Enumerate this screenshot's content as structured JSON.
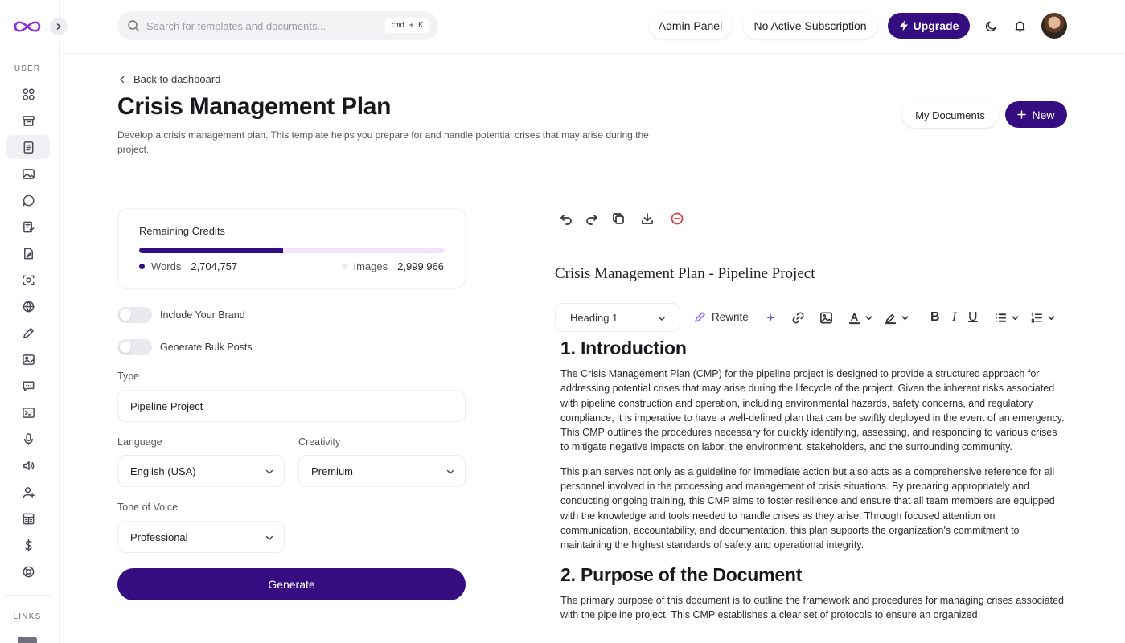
{
  "sidebar": {
    "section_user": "USER",
    "section_links": "LINKS",
    "items": [
      {
        "name": "sidebar-item-dashboard",
        "icon": "grid-icon"
      },
      {
        "name": "sidebar-item-archive",
        "icon": "archive-icon"
      },
      {
        "name": "sidebar-item-documents",
        "icon": "document-icon",
        "active": true
      },
      {
        "name": "sidebar-item-images",
        "icon": "image-icon"
      },
      {
        "name": "sidebar-item-chat",
        "icon": "chat-icon"
      },
      {
        "name": "sidebar-item-forms",
        "icon": "list-check-icon"
      },
      {
        "name": "sidebar-item-file-edit",
        "icon": "file-edit-icon"
      },
      {
        "name": "sidebar-item-vision",
        "icon": "scan-face-icon"
      },
      {
        "name": "sidebar-item-web",
        "icon": "globe-icon"
      },
      {
        "name": "sidebar-item-editor",
        "icon": "pen-icon"
      },
      {
        "name": "sidebar-item-image-gen",
        "icon": "image-icon"
      },
      {
        "name": "sidebar-item-chat-bot",
        "icon": "message-icon"
      },
      {
        "name": "sidebar-item-code",
        "icon": "terminal-icon"
      },
      {
        "name": "sidebar-item-speech",
        "icon": "mic-icon"
      },
      {
        "name": "sidebar-item-voiceover",
        "icon": "speaker-icon"
      },
      {
        "name": "sidebar-item-affiliates",
        "icon": "user-plus-icon"
      },
      {
        "name": "sidebar-item-plans",
        "icon": "table-icon"
      },
      {
        "name": "sidebar-item-billing",
        "icon": "dollar-icon"
      },
      {
        "name": "sidebar-item-support",
        "icon": "lifebuoy-icon"
      }
    ]
  },
  "topbar": {
    "search_placeholder": "Search for templates and documents...",
    "shortcut": "cmd + K",
    "admin_panel": "Admin Panel",
    "subscription": "No Active Subscription",
    "upgrade": "Upgrade"
  },
  "header": {
    "back": "Back to dashboard",
    "title": "Crisis Management Plan",
    "description": "Develop a crisis management plan. This template helps you prepare for and handle potential crises that may arise during the project.",
    "my_documents": "My Documents",
    "new": "New"
  },
  "credits": {
    "title": "Remaining Credits",
    "words_label": "Words",
    "words_value": "2,704,757",
    "images_label": "Images",
    "images_value": "2,999,966",
    "words_share": 0.47,
    "words_color": "#360d80",
    "images_color": "#f2e3fb"
  },
  "form": {
    "include_brand": "Include Your Brand",
    "bulk_posts": "Generate Bulk Posts",
    "type_label": "Type",
    "type_value": "Pipeline Project",
    "language_label": "Language",
    "language_value": "English (USA)",
    "creativity_label": "Creativity",
    "creativity_value": "Premium",
    "tone_label": "Tone of Voice",
    "tone_value": "Professional",
    "generate": "Generate"
  },
  "editor": {
    "doc_title": "Crisis Management Plan - Pipeline Project",
    "heading_select": "Heading 1",
    "rewrite": "Rewrite",
    "sections": [
      {
        "heading": "1. Introduction",
        "paragraphs": [
          "The Crisis Management Plan (CMP) for the pipeline project is designed to provide a structured approach for addressing potential crises that may arise during the lifecycle of the project. Given the inherent risks associated with pipeline construction and operation, including environmental hazards, safety concerns, and regulatory compliance, it is imperative to have a well-defined plan that can be swiftly deployed in the event of an emergency. This CMP outlines the procedures necessary for quickly identifying, assessing, and responding to various crises to mitigate negative impacts on labor, the environment, stakeholders, and the surrounding community.",
          "This plan serves not only as a guideline for immediate action but also acts as a comprehensive reference for all personnel involved in the processing and management of crisis situations. By preparing appropriately and conducting ongoing training, this CMP aims to foster resilience and ensure that all team members are equipped with the knowledge and tools needed to handle crises as they arise. Through focused attention on communication, accountability, and documentation, this plan supports the organization's commitment to maintaining the highest standards of safety and operational integrity."
        ]
      },
      {
        "heading": "2. Purpose of the Document",
        "paragraphs": [
          "The primary purpose of this document is to outline the framework and procedures for managing crises associated with the pipeline project. This CMP establishes a clear set of protocols to ensure an organized"
        ]
      }
    ]
  },
  "colors": {
    "brand": "#360d80",
    "danger": "#e0383e",
    "logo": "#8b2fd6"
  }
}
